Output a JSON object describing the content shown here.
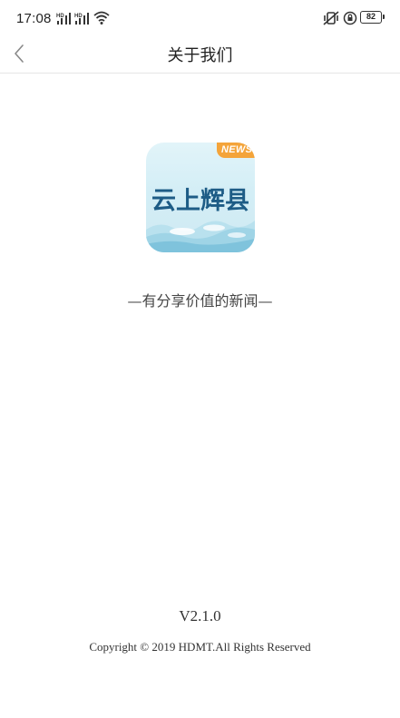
{
  "status_bar": {
    "time": "17:08",
    "battery": "82",
    "icons": [
      "hd-signal-icon",
      "hd-signal-icon",
      "wifi-icon",
      "vibrate-icon",
      "rotation-lock-icon",
      "battery-icon"
    ]
  },
  "nav": {
    "title": "关于我们",
    "back_icon": "chevron-left-icon"
  },
  "app_logo": {
    "badge": "NEWS",
    "name": "云上辉县"
  },
  "slogan": "—有分享价值的新闻—",
  "version": "V2.1.0",
  "copyright": "Copyright © 2019 HDMT.All Rights Reserved",
  "colors": {
    "logo_text": "#1d5c86",
    "badge": "#f4a43a",
    "logo_bg": "#d8f0f7"
  }
}
